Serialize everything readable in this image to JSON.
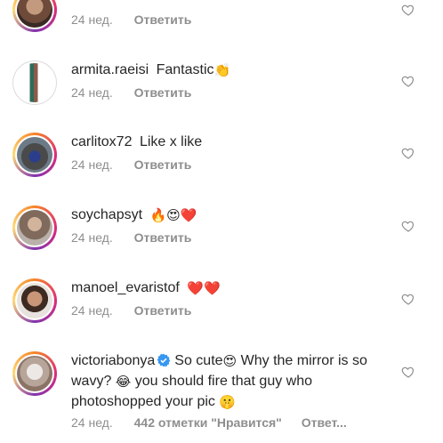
{
  "comments": [
    {
      "username": "",
      "text": "",
      "time": "24 нед.",
      "reply": "Ответить"
    },
    {
      "username": "armita.raeisi",
      "text": "Fantastic",
      "emoji": "👏",
      "time": "24 нед.",
      "reply": "Ответить"
    },
    {
      "username": "carlitox72",
      "text": "Like x like",
      "time": "24 нед.",
      "reply": "Ответить"
    },
    {
      "username": "soychapsyt",
      "text": "",
      "emoji": "🔥😍❤️",
      "time": "24 нед.",
      "reply": "Ответить"
    },
    {
      "username": "manoel_evaristof",
      "text": "",
      "emoji": "❤️❤️",
      "time": "24 нед.",
      "reply": "Ответить"
    },
    {
      "username": "victoriabonya",
      "text1": "So cute",
      "emoji1": "😍",
      "text2": " Why the mirror is so wavy? ",
      "emoji2": "😂",
      "text3": " you should fire that guy who photoshopped your pic ",
      "emoji3": "🤫",
      "time": "24 нед.",
      "likes": "442 отметки \"Нравится\"",
      "reply": "Ответ..."
    }
  ],
  "colors": {
    "text": "#262626",
    "meta": "#8e8e8e",
    "verified": "#3897f0"
  },
  "icons": {
    "like": "heart-outline-icon",
    "verified": "verified-badge-icon"
  }
}
